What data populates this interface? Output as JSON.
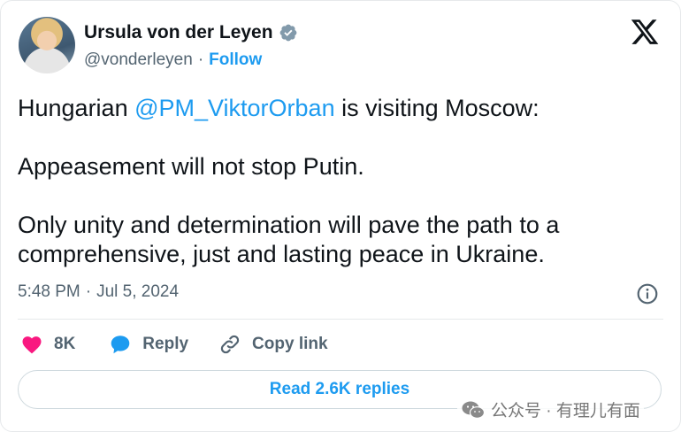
{
  "author": {
    "name": "Ursula von der Leyen",
    "handle": "@vonderleyen",
    "separator": "·",
    "follow_label": "Follow"
  },
  "post": {
    "p1_prefix": "Hungarian ",
    "p1_mention": "@PM_ViktorOrban",
    "p1_suffix": " is visiting Moscow:",
    "p2": "Appeasement will not stop Putin.",
    "p3": "Only unity and determination will pave the path to a comprehensive, just and lasting peace in Ukraine."
  },
  "meta": {
    "time": "5:48 PM",
    "separator": "·",
    "date": "Jul 5, 2024"
  },
  "actions": {
    "likes": "8K",
    "reply_label": "Reply",
    "copy_label": "Copy link"
  },
  "replies_button": "Read 2.6K replies",
  "watermark": "公众号 · 有理儿有面",
  "colors": {
    "accent": "#1d9bf0",
    "like": "#f91880",
    "muted": "#536471",
    "text": "#0f1419"
  },
  "icons": [
    "verified-badge-icon",
    "x-logo-icon",
    "info-icon",
    "heart-icon",
    "reply-bubble-icon",
    "link-icon",
    "wechat-icon"
  ]
}
